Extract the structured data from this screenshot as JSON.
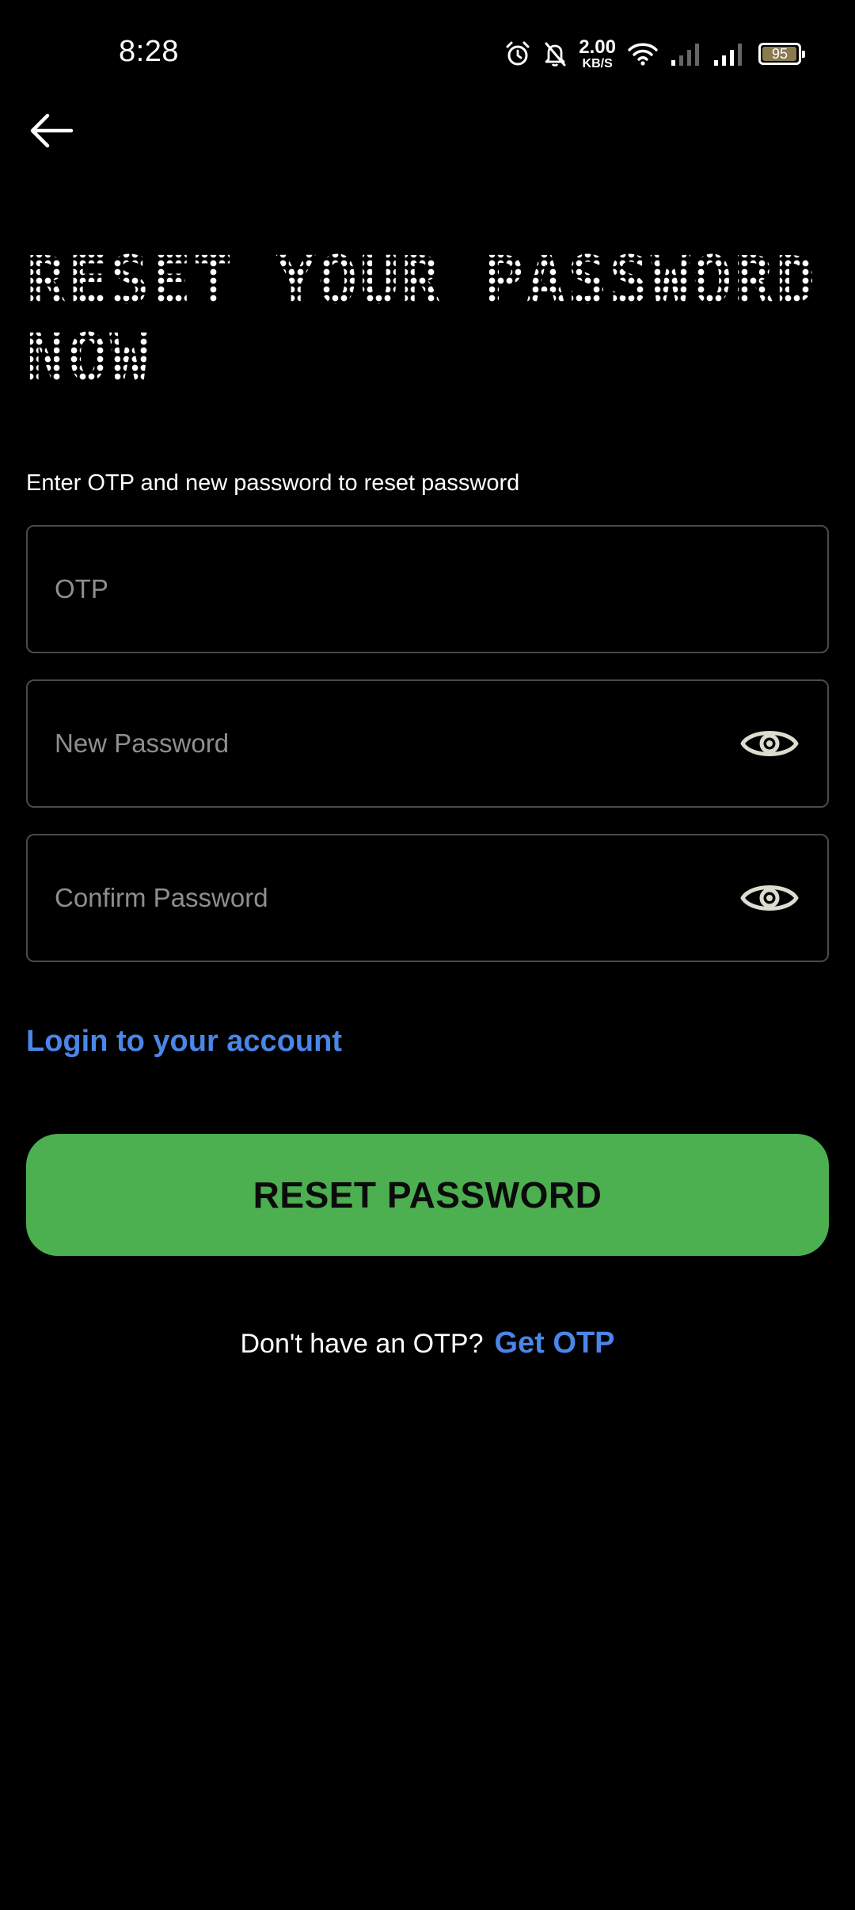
{
  "status_bar": {
    "time": "8:28",
    "net_speed_value": "2.00",
    "net_speed_unit": "KB/S",
    "battery_level": "95",
    "icons": [
      "alarm-icon",
      "bell-off-icon",
      "wifi-icon",
      "cell-signal-icon",
      "cell-signal-icon",
      "battery-icon"
    ],
    "battery_color": "#8a7a50"
  },
  "header": {
    "back_icon": "arrow-left-icon",
    "title": "RESET YOUR PASSWORD NOW"
  },
  "form": {
    "instructions": "Enter OTP and new password to reset password",
    "otp_field": {
      "placeholder": "OTP",
      "value": ""
    },
    "new_password_field": {
      "placeholder": "New Password",
      "value": "",
      "toggle_icon": "eye-icon"
    },
    "confirm_password_field": {
      "placeholder": "Confirm Password",
      "value": "",
      "toggle_icon": "eye-icon"
    },
    "login_link": "Login to your account",
    "submit_label": "RESET PASSWORD"
  },
  "footer": {
    "prompt": "Don't have an OTP?",
    "link": "Get OTP"
  },
  "colors": {
    "background": "#000000",
    "accent_green": "#4caf50",
    "link_blue": "#4a86e8",
    "field_border": "#4a4a4a",
    "placeholder_gray": "#8e8e8e"
  }
}
